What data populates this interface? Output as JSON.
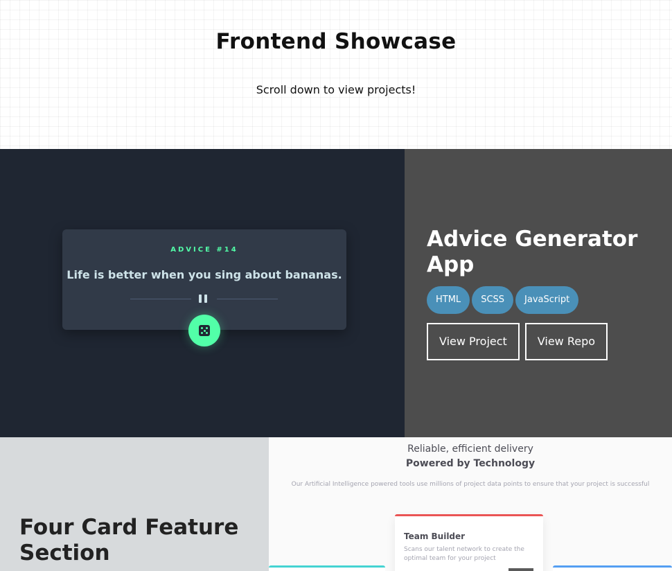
{
  "hero": {
    "title": "Frontend Showcase",
    "subtitle": "Scroll down to view projects!"
  },
  "projects": [
    {
      "title": "Advice Generator App",
      "tags": [
        "HTML",
        "SCSS",
        "JavaScript"
      ],
      "buttons": {
        "view_project": "View Project",
        "view_repo": "View Repo"
      },
      "preview": {
        "label": "ADVICE #14",
        "quote": "Life is better when you sing about bananas.",
        "icons": [
          "pause-icon",
          "dice-icon"
        ]
      }
    },
    {
      "title": "Four Card Feature Section",
      "preview": {
        "heading_light": "Reliable, efficient delivery",
        "heading_bold": "Powered by Technology",
        "description": "Our Artificial Intelligence powered tools use millions of project data points to ensure that your project is successful",
        "card_title": "Team Builder",
        "card_text": "Scans our talent network to create the optimal team for your project"
      }
    }
  ],
  "colors": {
    "p1_image_bg": "#1f2632",
    "p1_info_bg": "#4d4d4d",
    "tag_bg": "#4a90b8",
    "advice_accent": "#52ffa8",
    "p2_info_bg": "#d7dadc",
    "card_accent_red": "#ea5454",
    "card_accent_cyan": "#44d3d2",
    "card_accent_blue": "#549ef2"
  }
}
